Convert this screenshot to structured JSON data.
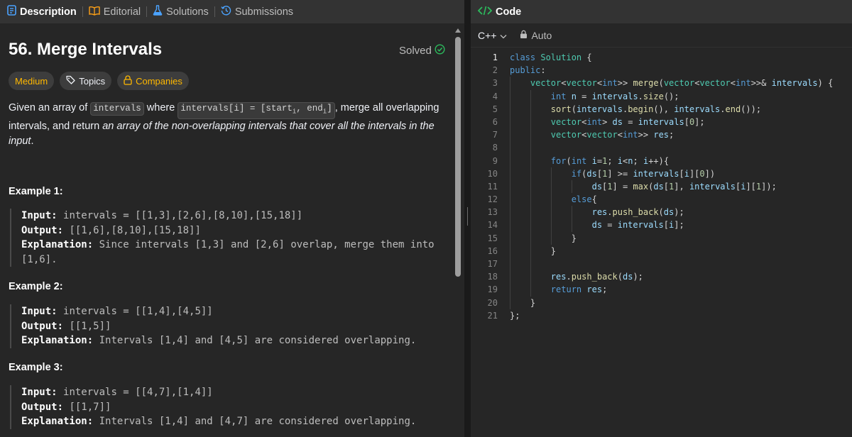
{
  "tabs": [
    {
      "label": "Description",
      "icon": "description-icon",
      "active": true
    },
    {
      "label": "Editorial",
      "icon": "book-icon",
      "active": false
    },
    {
      "label": "Solutions",
      "icon": "flask-icon",
      "active": false
    },
    {
      "label": "Submissions",
      "icon": "history-icon",
      "active": false
    }
  ],
  "problem": {
    "title": "56. Merge Intervals",
    "status": "Solved",
    "difficulty": "Medium",
    "topics_label": "Topics",
    "companies_label": "Companies",
    "description": {
      "p1": "Given an array of ",
      "code1": "intervals",
      "p2": " where ",
      "code2": "intervals[i] = [start",
      "code2_sub": "i",
      "code2b": ", end",
      "code2b_sub": "i",
      "code2c": "]",
      "p3": ", merge all overlapping intervals, and return ",
      "em": "an array of the non-overlapping intervals that cover all the intervals in the input",
      "p4": "."
    }
  },
  "examples": [
    {
      "title": "Example 1:",
      "input_label": "Input:",
      "input": "intervals = [[1,3],[2,6],[8,10],[15,18]]",
      "output_label": "Output:",
      "output": "[[1,6],[8,10],[15,18]]",
      "explanation_label": "Explanation:",
      "explanation": "Since intervals [1,3] and [2,6] overlap, merge them into [1,6]."
    },
    {
      "title": "Example 2:",
      "input_label": "Input:",
      "input": "intervals = [[1,4],[4,5]]",
      "output_label": "Output:",
      "output": "[[1,5]]",
      "explanation_label": "Explanation:",
      "explanation": "Intervals [1,4] and [4,5] are considered overlapping."
    },
    {
      "title": "Example 3:",
      "input_label": "Input:",
      "input": "intervals = [[4,7],[1,4]]",
      "output_label": "Output:",
      "output": "[[1,7]]",
      "explanation_label": "Explanation:",
      "explanation": "Intervals [1,4] and [4,7] are considered overlapping."
    }
  ],
  "editor": {
    "header_title": "Code",
    "header_icon": "code-icon",
    "language": "C++",
    "mode": "Auto",
    "current_line": 1,
    "lines": [
      "class Solution {",
      "public:",
      "    vector<vector<int>> merge(vector<vector<int>>& intervals) {",
      "        int n = intervals.size();",
      "        sort(intervals.begin(), intervals.end());",
      "        vector<int> ds = intervals[0];",
      "        vector<vector<int>> res;",
      "",
      "        for(int i=1; i<n; i++){",
      "            if(ds[1] >= intervals[i][0])",
      "                ds[1] = max(ds[1], intervals[i][1]);",
      "            else{",
      "                res.push_back(ds);",
      "                ds = intervals[i];",
      "            }",
      "        }",
      "",
      "        res.push_back(ds);",
      "        return res;",
      "    }",
      "};"
    ]
  },
  "colors": {
    "accent_green": "#2cbb5d",
    "medium": "#ffb800",
    "code_icon": "#ffa116",
    "link_blue": "#2196f3"
  }
}
